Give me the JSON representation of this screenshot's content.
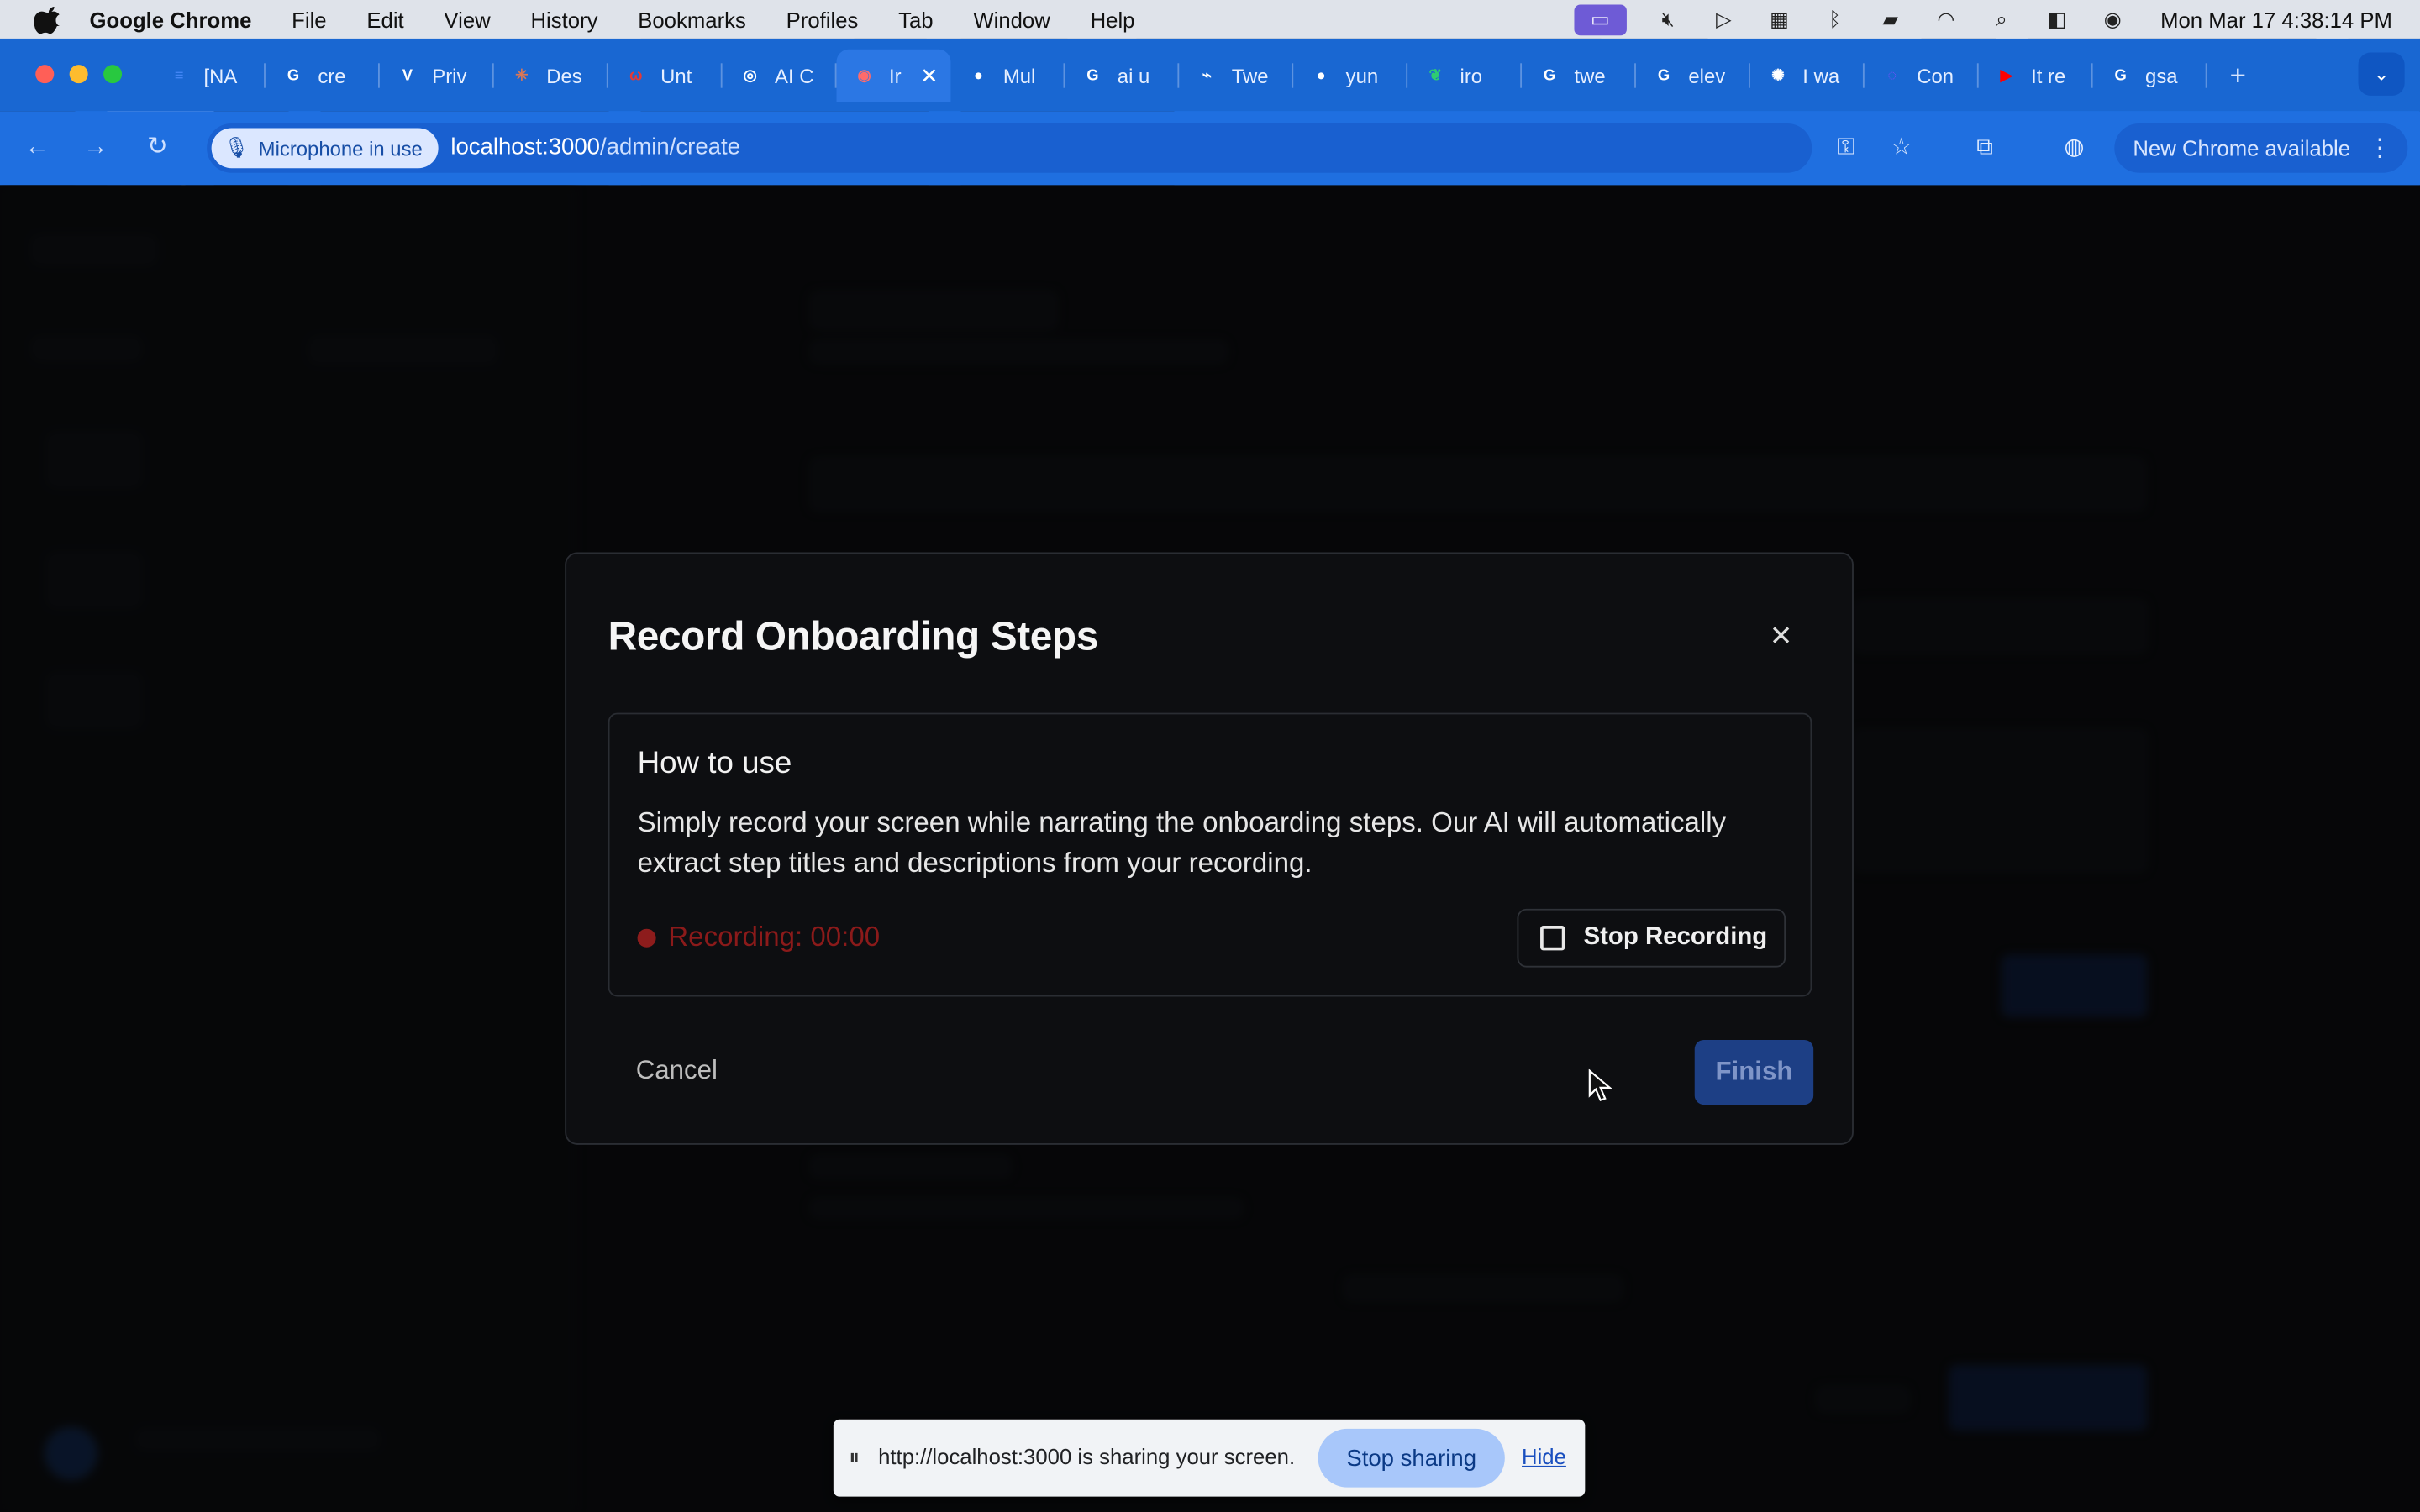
{
  "menubar": {
    "app_name": "Google Chrome",
    "items": [
      "File",
      "Edit",
      "View",
      "History",
      "Bookmarks",
      "Profiles",
      "Tab",
      "Window",
      "Help"
    ],
    "clock": "Mon Mar 17  4:38:14 PM"
  },
  "tabs": [
    {
      "label": "[NA",
      "icon": "docs-icon",
      "color": "#4285f4"
    },
    {
      "label": "cre",
      "icon": "google-icon",
      "color": "#ffffff"
    },
    {
      "label": "Priv",
      "icon": "vo-icon",
      "color": "#ffffff"
    },
    {
      "label": "Des",
      "icon": "claude-icon",
      "color": "#d97757"
    },
    {
      "label": "Unt",
      "icon": "untitled-icon",
      "color": "#e53935"
    },
    {
      "label": "AI C",
      "icon": "openai-icon",
      "color": "#ffffff"
    },
    {
      "label": "Ir",
      "icon": "recording-icon",
      "color": "#ff6b6b",
      "active": true
    },
    {
      "label": "Mul",
      "icon": "github-icon",
      "color": "#ffffff"
    },
    {
      "label": "ai u",
      "icon": "google-icon",
      "color": "#ffffff"
    },
    {
      "label": "Twe",
      "icon": "tweet-icon",
      "color": "#ffffff"
    },
    {
      "label": "yun",
      "icon": "github-icon",
      "color": "#ffffff"
    },
    {
      "label": "iro",
      "icon": "leaf-icon",
      "color": "#2ecc71"
    },
    {
      "label": "twe",
      "icon": "google-icon",
      "color": "#ffffff"
    },
    {
      "label": "elev",
      "icon": "google-icon",
      "color": "#ffffff"
    },
    {
      "label": "I wa",
      "icon": "star-burst-icon",
      "color": "#ffffff"
    },
    {
      "label": "Con",
      "icon": "spiral-icon",
      "color": "#7c4dff"
    },
    {
      "label": "It re",
      "icon": "youtube-icon",
      "color": "#ff0000"
    },
    {
      "label": "gsa",
      "icon": "google-icon",
      "color": "#ffffff"
    }
  ],
  "toolbar": {
    "mic_chip": "Microphone in use",
    "url_host": "localhost:3000",
    "url_path": "/admin/create",
    "update_label": "New Chrome available"
  },
  "modal": {
    "title": "Record Onboarding Steps",
    "howto_title": "How to use",
    "howto_body": "Simply record your screen while narrating the onboarding steps. Our AI will automatically extract step titles and descriptions from your recording.",
    "recording_status": "Recording: 00:00",
    "stop_label": "Stop Recording",
    "cancel_label": "Cancel",
    "finish_label": "Finish"
  },
  "sharebar": {
    "message": "http://localhost:3000 is sharing your screen.",
    "stop_label": "Stop sharing",
    "hide_label": "Hide"
  },
  "colors": {
    "tab_strip": "#1967d2",
    "recording_red": "#8d1c1c",
    "finish_button": "#1d3f85"
  }
}
